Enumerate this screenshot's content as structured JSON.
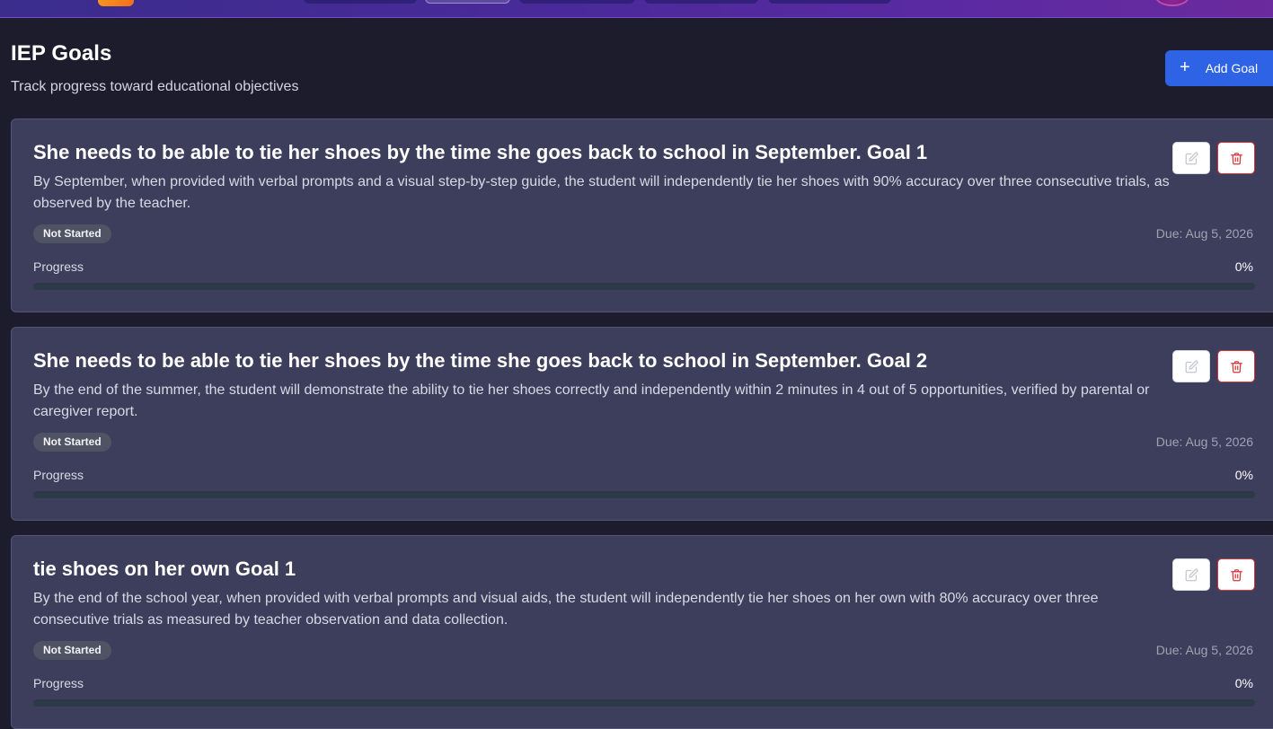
{
  "nav": {
    "icons": [
      "app-logo-icon",
      "user-avatar-icon"
    ]
  },
  "header": {
    "title": "IEP Goals",
    "subtitle": "Track progress toward educational objectives",
    "add_button_label": "Add Goal",
    "add_button_icon": "plus-icon"
  },
  "goals": [
    {
      "title": "She needs to be able to tie her shoes by the time she goes back to school in September. Goal 1",
      "description": "By September, when provided with verbal prompts and a visual step-by-step guide, the student will independently tie her shoes with 90% accuracy over three consecutive trials, as observed by the teacher.",
      "status": "Not Started",
      "due": "Due: Aug 5, 2026",
      "progress_label": "Progress",
      "progress_text": "0%",
      "progress_percent": 0
    },
    {
      "title": "She needs to be able to tie her shoes by the time she goes back to school in September. Goal 2",
      "description": "By the end of the summer, the student will demonstrate the ability to tie her shoes correctly and independently within 2 minutes in 4 out of 5 opportunities, verified by parental or caregiver report.",
      "status": "Not Started",
      "due": "Due: Aug 5, 2026",
      "progress_label": "Progress",
      "progress_text": "0%",
      "progress_percent": 0
    },
    {
      "title": "tie shoes on her own Goal 1",
      "description": "By the end of the school year, when provided with verbal prompts and visual aids, the student will independently tie her shoes on her own with 80% accuracy over three consecutive trials as measured by teacher observation and data collection.",
      "status": "Not Started",
      "due": "Due: Aug 5, 2026",
      "progress_label": "Progress",
      "progress_text": "0%",
      "progress_percent": 0
    }
  ],
  "colors": {
    "accent": "#2f63e6",
    "card_bg": "#3d3e5c",
    "delete": "#d9343a",
    "progress_track": "#2c3a48"
  }
}
